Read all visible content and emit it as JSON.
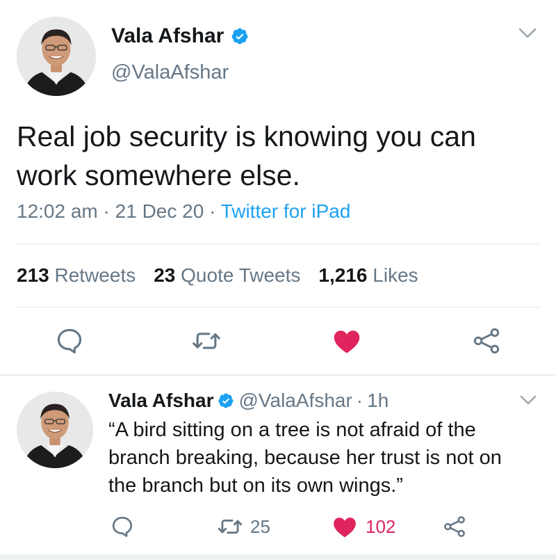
{
  "main_tweet": {
    "author_name": "Vala Afshar",
    "author_handle": "@ValaAfshar",
    "text": "Real job security is knowing you can work somewhere else.",
    "time": "12:02 am",
    "date": "21 Dec 20",
    "source": "Twitter for iPad",
    "separator": "·",
    "stats": {
      "retweets_count": "213",
      "retweets_label": "Retweets",
      "quote_count": "23",
      "quote_label": "Quote Tweets",
      "likes_count": "1,216",
      "likes_label": "Likes"
    },
    "liked": true
  },
  "reply_tweet": {
    "author_name": "Vala Afshar",
    "author_handle": "@ValaAfshar",
    "separator": "·",
    "age": "1h",
    "text": "“A bird sitting on a tree is not afraid of the branch breaking, because her trust is not on the branch but on its own wings.”",
    "retweet_count": "25",
    "like_count": "102",
    "liked": true
  },
  "icons": {
    "reply": "speech-bubble-icon",
    "retweet": "retweet-icon",
    "like": "heart-icon",
    "share": "share-icon",
    "verified": "verified-badge-icon",
    "menu": "chevron-down-icon"
  },
  "colors": {
    "text": "#14171a",
    "muted": "#657786",
    "link": "#1da1f2",
    "like": "#e0245e",
    "verified": "#1da1f2",
    "divider": "#e1e8ed"
  }
}
